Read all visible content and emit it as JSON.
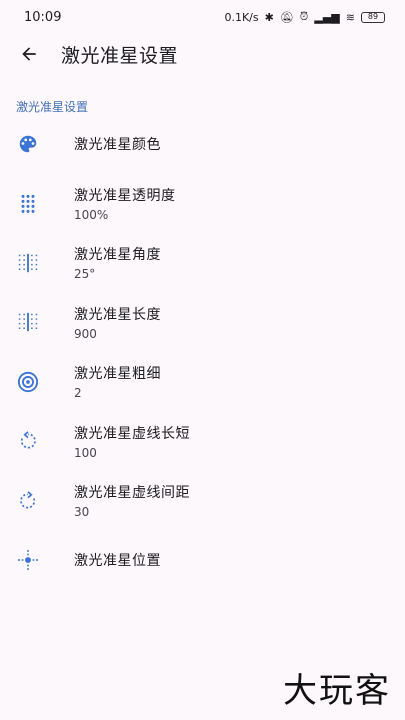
{
  "status_bar": {
    "time": "10:09",
    "network_speed": "0.1K/s",
    "battery": "89"
  },
  "app_bar": {
    "title": "激光准星设置"
  },
  "section_header": "激光准星设置",
  "colors": {
    "accent": "#3f6ebf",
    "icon": "#3a74d6",
    "background": "#fcf8fc"
  },
  "settings": [
    {
      "title": "激光准星颜色",
      "summary": null,
      "icon": "palette-icon"
    },
    {
      "title": "激光准星透明度",
      "summary": "100%",
      "icon": "dots-grid-icon"
    },
    {
      "title": "激光准星角度",
      "summary": "25°",
      "icon": "dotted-lines-icon"
    },
    {
      "title": "激光准星长度",
      "summary": "900",
      "icon": "dotted-lines-icon"
    },
    {
      "title": "激光准星粗细",
      "summary": "2",
      "icon": "target-icon"
    },
    {
      "title": "激光准星虚线长短",
      "summary": "100",
      "icon": "rotate-left-icon"
    },
    {
      "title": "激光准星虚线间距",
      "summary": "30",
      "icon": "rotate-right-icon"
    },
    {
      "title": "激光准星位置",
      "summary": null,
      "icon": "crosshair-icon"
    }
  ],
  "watermark": "大玩客"
}
